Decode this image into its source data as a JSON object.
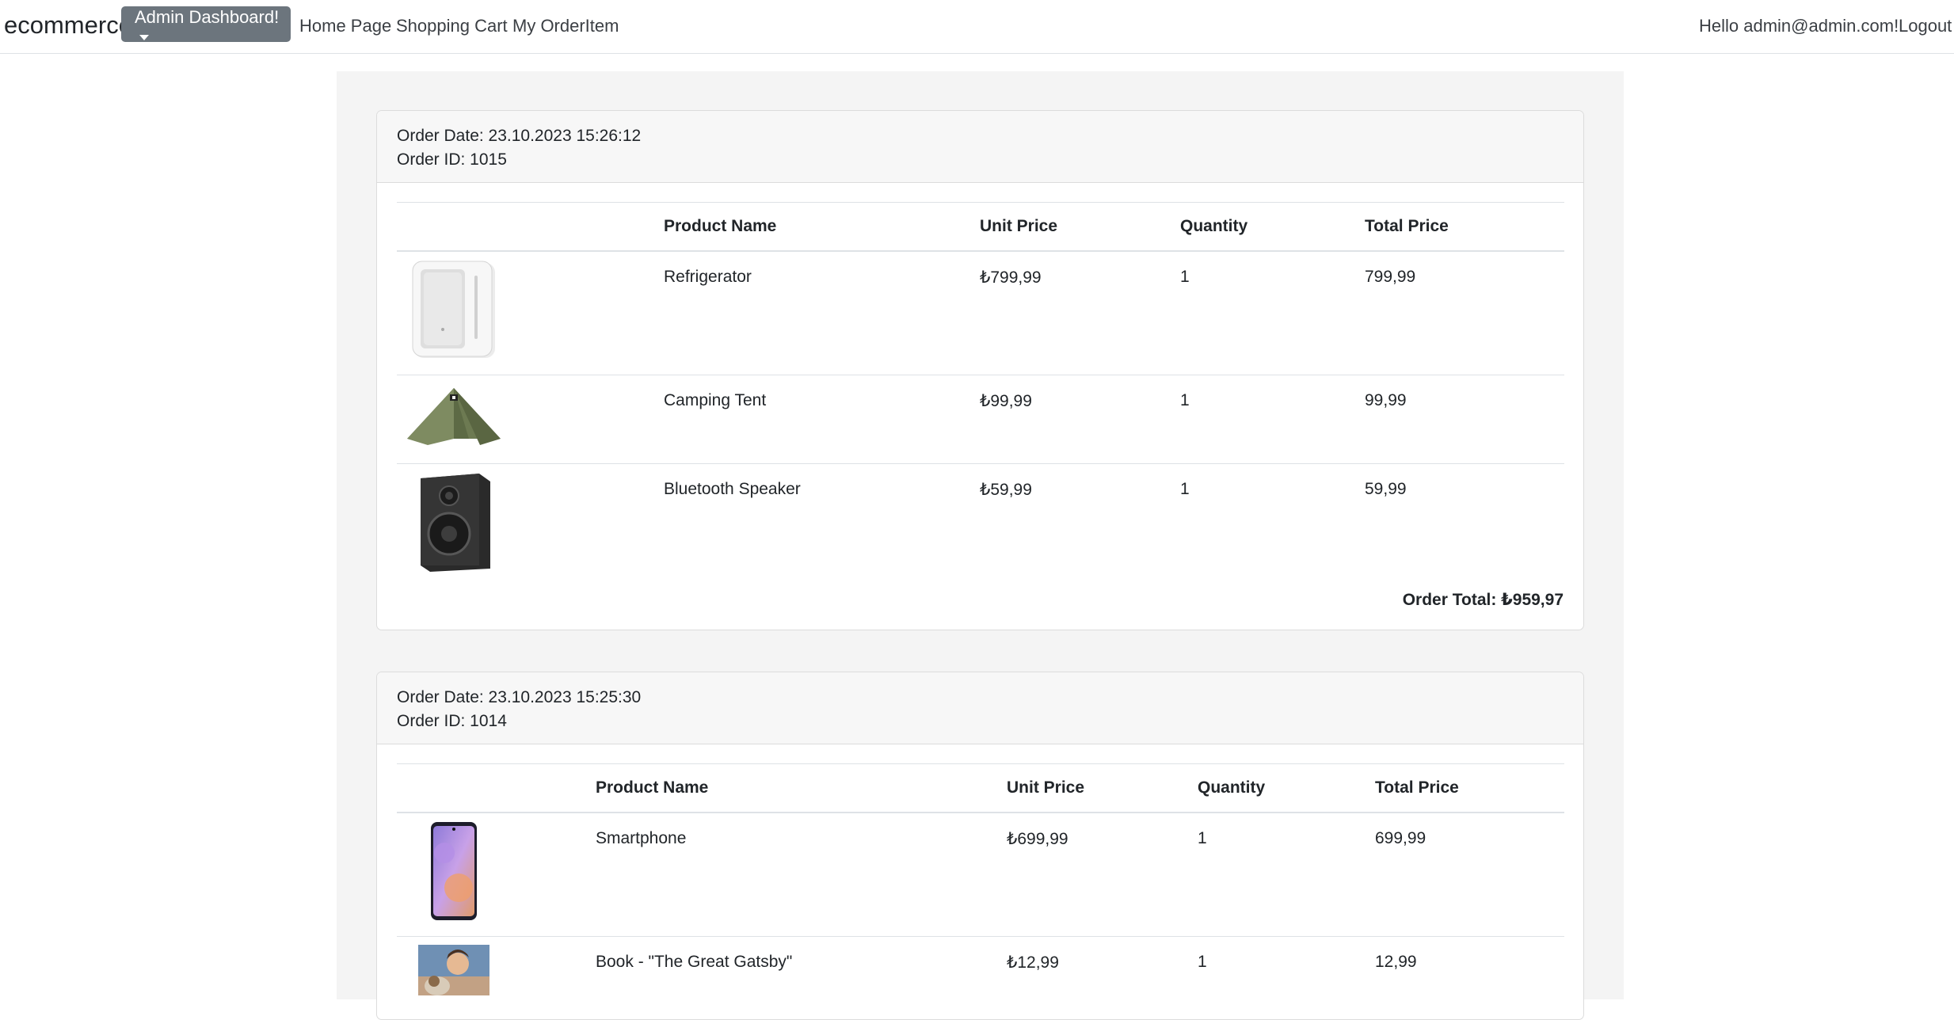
{
  "nav": {
    "brand": "ecommerce",
    "admin_dropdown": "Admin Dashboard!",
    "links": [
      "Home Page",
      "Shopping Cart",
      "My OrderItem"
    ],
    "greeting": "Hello admin@admin.com!",
    "logout": "Logout"
  },
  "table_headers": {
    "product_name": "Product Name",
    "unit_price": "Unit Price",
    "quantity": "Quantity",
    "total_price": "Total Price"
  },
  "orders": [
    {
      "date_label": "Order Date: 23.10.2023 15:26:12",
      "id_label": "Order ID: 1015",
      "items": [
        {
          "image": "refrigerator-image",
          "name": "Refrigerator",
          "unit_price": "₺799,99",
          "quantity": "1",
          "total": "799,99"
        },
        {
          "image": "camping-tent-image",
          "name": "Camping Tent",
          "unit_price": "₺99,99",
          "quantity": "1",
          "total": "99,99"
        },
        {
          "image": "bluetooth-speaker-image",
          "name": "Bluetooth Speaker",
          "unit_price": "₺59,99",
          "quantity": "1",
          "total": "59,99"
        }
      ],
      "total_label": "Order Total: ₺959,97"
    },
    {
      "date_label": "Order Date: 23.10.2023 15:25:30",
      "id_label": "Order ID: 1014",
      "items": [
        {
          "image": "smartphone-image",
          "name": "Smartphone",
          "unit_price": "₺699,99",
          "quantity": "1",
          "total": "699,99"
        },
        {
          "image": "book-cover-image",
          "name": "Book - \"The Great Gatsby\"",
          "unit_price": "₺12,99",
          "quantity": "1",
          "total": "12,99"
        }
      ]
    }
  ]
}
